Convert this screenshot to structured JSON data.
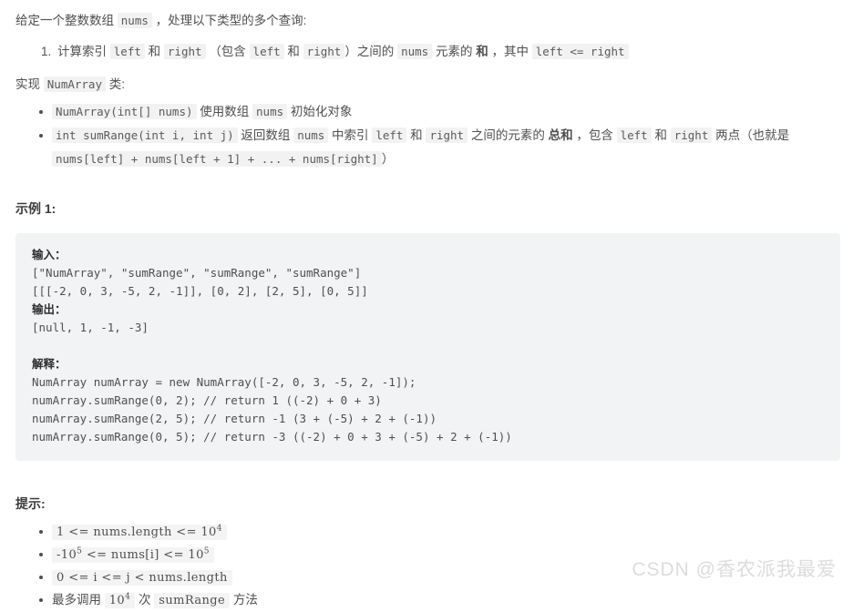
{
  "document": {
    "intro": {
      "prefix": "给定一个整数数组 ",
      "code_nums": "nums",
      "suffix": " ，处理以下类型的多个查询:"
    },
    "query_list": [
      {
        "number": "1.",
        "p1": "计算索引 ",
        "c1": "left",
        "p2": " 和 ",
        "c2": "right",
        "p3": " （包含 ",
        "c3": "left",
        "p4": " 和 ",
        "c4": "right",
        "p5": "）之间的 ",
        "c5": "nums",
        "p6": " 元素的 ",
        "bold1": "和",
        "p7": " ，其中 ",
        "c6": "left <= right"
      }
    ],
    "implement": {
      "prefix": "实现 ",
      "class_name": "NumArray",
      "suffix": " 类:"
    },
    "api_list": [
      {
        "code": "NumArray(int[] nums)",
        "p1": " 使用数组 ",
        "c1": "nums",
        "p2": " 初始化对象"
      },
      {
        "code": "int sumRange(int i, int j)",
        "p1": " 返回数组 ",
        "c1": "nums",
        "p2": " 中索引 ",
        "c2": "left",
        "p3": " 和 ",
        "c3": "right",
        "p4": " 之间的元素的 ",
        "bold1": "总和",
        "p5": " ，包含 ",
        "c4": "left",
        "p6": " 和 ",
        "c5": "right",
        "p7": " 两点（也就是 ",
        "c6": "nums[left] + nums[left + 1] + ... + nums[right]",
        "p8": "）"
      }
    ],
    "example": {
      "title": "示例 1:",
      "input_label": "输入：",
      "input_lines": [
        "[\"NumArray\", \"sumRange\", \"sumRange\", \"sumRange\"]",
        "[[[-2, 0, 3, -5, 2, -1]], [0, 2], [2, 5], [0, 5]]"
      ],
      "output_label": "输出：",
      "output_lines": [
        "[null, 1, -1, -3]"
      ],
      "explain_label": "解释：",
      "explain_lines": [
        "NumArray numArray = new NumArray([-2, 0, 3, -5, 2, -1]);",
        "numArray.sumRange(0, 2); // return 1 ((-2) + 0 + 3)",
        "numArray.sumRange(2, 5); // return -1 (3 + (-5) + 2 + (-1))",
        "numArray.sumRange(0, 5); // return -3 ((-2) + 0 + 3 + (-5) + 2 + (-1))"
      ]
    },
    "hints": {
      "title": "提示:",
      "items": [
        {
          "type": "math",
          "pre": "1 <= nums.length <= 10",
          "sup": "4",
          "post": ""
        },
        {
          "type": "math",
          "pre": "-10",
          "sup": "5",
          "post": " <= nums[i] <= 10",
          "sup2": "5"
        },
        {
          "type": "math",
          "pre": "0 <= i <= j < nums.length",
          "sup": "",
          "post": ""
        },
        {
          "type": "mixed",
          "text1": "最多调用 ",
          "m1": "10",
          "m1sup": "4",
          "text2": " 次 ",
          "m2": "sumRange",
          "text3": " 方法"
        }
      ]
    },
    "watermark": "CSDN @香农派我最爱"
  }
}
